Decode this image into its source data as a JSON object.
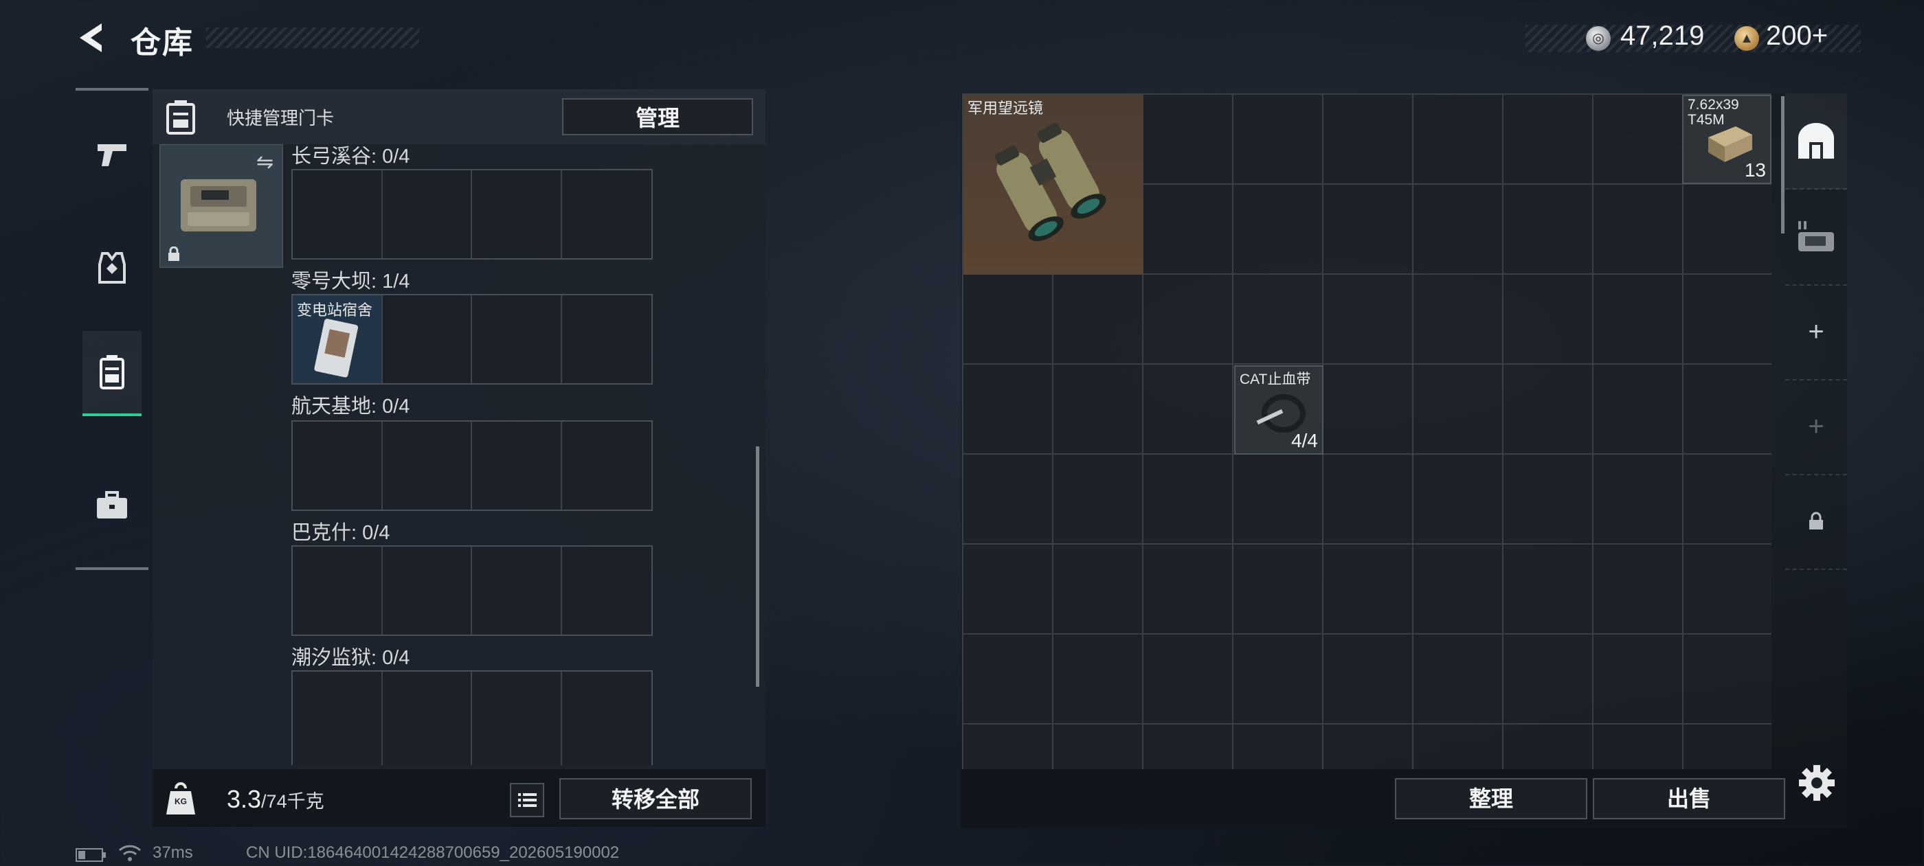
{
  "header": {
    "title": "仓库",
    "currency": [
      {
        "icon": "silver-coin-icon",
        "value": "47,219"
      },
      {
        "icon": "gold-coin-icon",
        "value": "200+"
      }
    ]
  },
  "left_panel": {
    "header_title": "快捷管理门卡",
    "manage_label": "管理",
    "sections": [
      {
        "label": "长弓溪谷: 0/4",
        "slots": []
      },
      {
        "label": "零号大坝: 1/4",
        "slots": [
          {
            "name": "变电站宿舍"
          }
        ]
      },
      {
        "label": "航天基地: 0/4",
        "slots": []
      },
      {
        "label": "巴克什: 0/4",
        "slots": []
      },
      {
        "label": "潮汐监狱: 0/4",
        "slots": []
      }
    ],
    "weight": {
      "current": "3.3",
      "max": "/74千克",
      "icon_label": "KG"
    },
    "transfer_all_label": "转移全部"
  },
  "stash": {
    "items": [
      {
        "name": "军用望远镜",
        "count": ""
      },
      {
        "name": "7.62x39\nT45M",
        "count": "13"
      },
      {
        "name": "CAT止血带",
        "count": "4/4"
      }
    ],
    "sort_label": "整理",
    "sell_label": "出售"
  },
  "status_bar": {
    "ping": "37ms",
    "uid": "CN UID:186464001424288700659_202605190002"
  },
  "colors": {
    "accent": "#2ecc8f",
    "panel": "#1e242c"
  }
}
